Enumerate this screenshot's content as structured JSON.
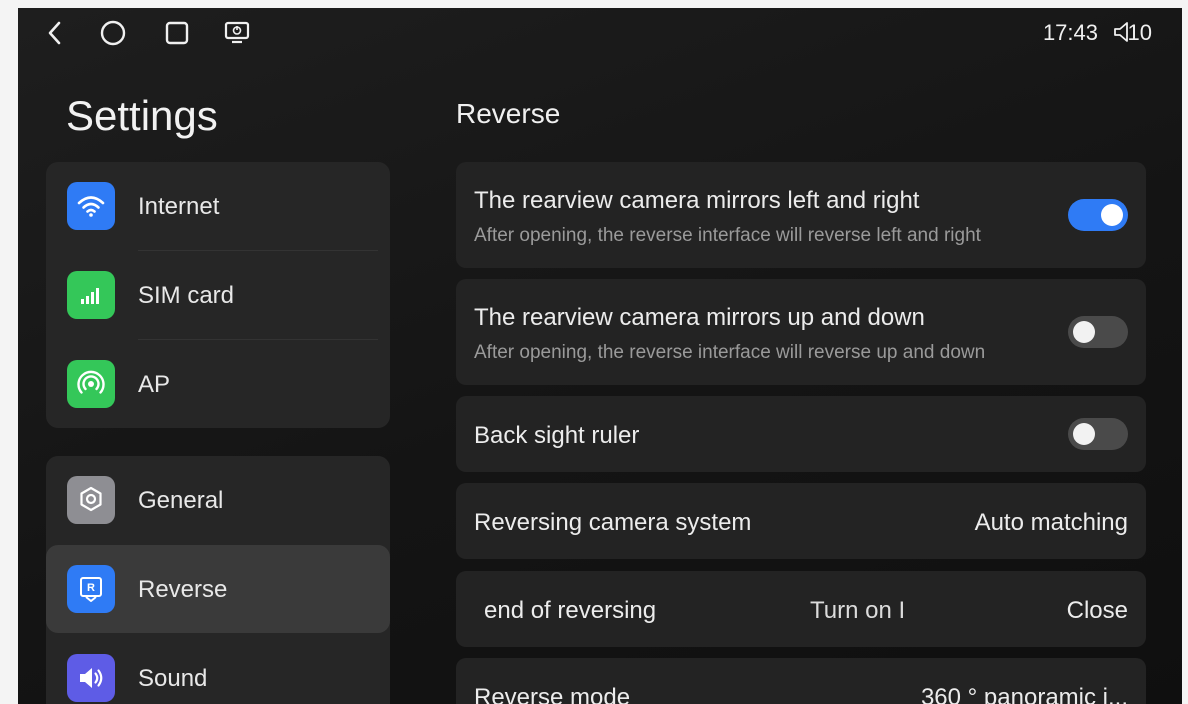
{
  "status_bar": {
    "time": "17:43",
    "volume_level": "10",
    "nav_icons": [
      "back-icon",
      "home-icon",
      "recents-icon",
      "screen-off-icon"
    ]
  },
  "sidebar": {
    "title": "Settings",
    "groups": [
      {
        "items": [
          {
            "label": "Internet",
            "icon": "wifi-icon",
            "color": "#2f7bf5"
          },
          {
            "label": "SIM card",
            "icon": "signal-icon",
            "color": "#34c759"
          },
          {
            "label": "AP",
            "icon": "hotspot-icon",
            "color": "#34c759"
          }
        ]
      },
      {
        "items": [
          {
            "label": "General",
            "icon": "gear-icon",
            "color": "#8e8e93"
          },
          {
            "label": "Reverse",
            "icon": "reverse-icon",
            "color": "#2f7bf5",
            "active": true
          },
          {
            "label": "Sound",
            "icon": "speaker-icon",
            "color": "#5e5ce6"
          }
        ]
      }
    ]
  },
  "main": {
    "title": "Reverse",
    "settings": [
      {
        "title": "The rearview camera mirrors left and right",
        "subtitle": "After opening, the reverse interface will reverse left and right",
        "toggle": true
      },
      {
        "title": "The rearview camera mirrors up and down",
        "subtitle": "After opening, the reverse interface will reverse up and down",
        "toggle": false
      },
      {
        "title": "Back sight ruler",
        "toggle": false
      },
      {
        "title": "Reversing camera system",
        "value": "Auto matching"
      },
      {
        "title": "end of reversing",
        "middle": "Turn on I",
        "value": "Close"
      },
      {
        "title": "Reverse mode",
        "value": "360 ° panoramic i..."
      }
    ]
  },
  "colors": {
    "accent": "#2f7bf5",
    "background": "#141414",
    "card": "#232323"
  }
}
